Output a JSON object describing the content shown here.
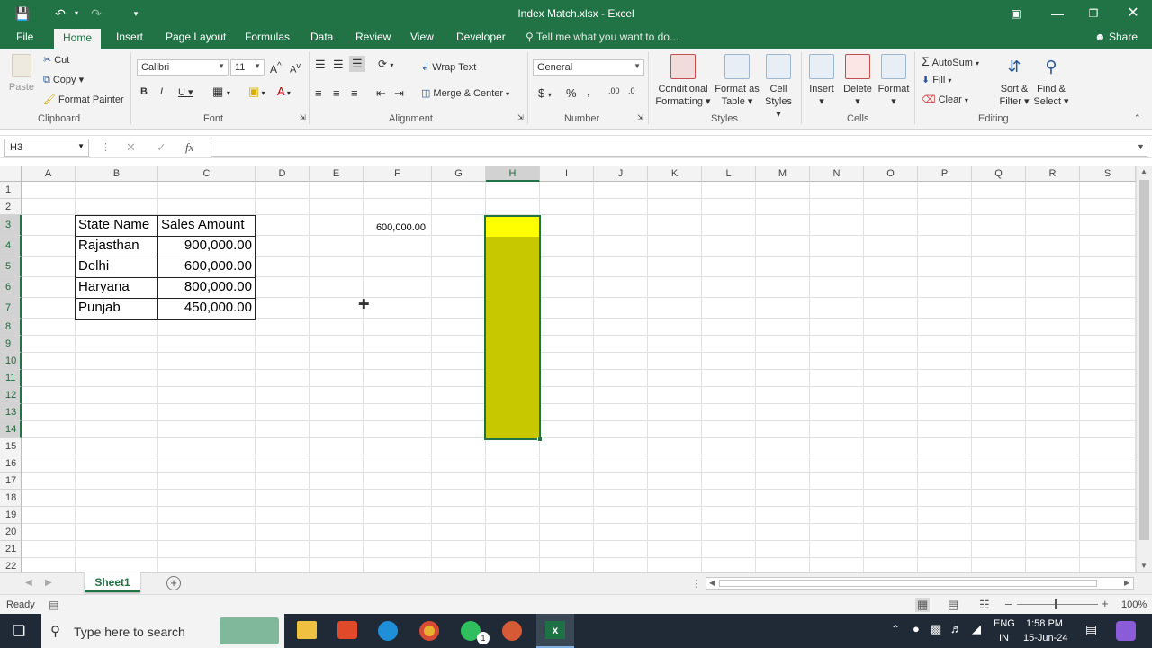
{
  "window": {
    "title": "Index Match.xlsx  -  Excel"
  },
  "qat": {
    "save_icon": "save-icon",
    "undo_icon": "undo-icon",
    "redo_icon": "redo-icon",
    "customize_icon": "customize-icon"
  },
  "tabs": [
    "File",
    "Home",
    "Insert",
    "Page Layout",
    "Formulas",
    "Data",
    "Review",
    "View",
    "Developer"
  ],
  "tell_me": "Tell me what you want to do...",
  "share": "Share",
  "clipboard": {
    "paste": "Paste",
    "cut": "Cut",
    "copy": "Copy",
    "format_painter": "Format Painter",
    "label": "Clipboard"
  },
  "font": {
    "name": "Calibri",
    "size": "11",
    "label": "Font"
  },
  "alignment": {
    "wrap": "Wrap Text",
    "merge": "Merge & Center",
    "label": "Alignment"
  },
  "number": {
    "format": "General",
    "label": "Number"
  },
  "styles": {
    "conditional": [
      "Conditional",
      "Formatting"
    ],
    "format_table": [
      "Format as",
      "Table"
    ],
    "cell_styles": [
      "Cell",
      "Styles"
    ],
    "label": "Styles"
  },
  "cells": {
    "insert": "Insert",
    "delete": "Delete",
    "format": "Format",
    "label": "Cells"
  },
  "editing": {
    "autosum": "AutoSum",
    "fill": "Fill",
    "clear": "Clear",
    "sort": [
      "Sort &",
      "Filter"
    ],
    "find": [
      "Find &",
      "Select"
    ],
    "label": "Editing"
  },
  "formula_bar": {
    "name_box": "H3",
    "fx": "fx",
    "value": ""
  },
  "columns": [
    "A",
    "B",
    "C",
    "D",
    "E",
    "F",
    "G",
    "H",
    "I",
    "J",
    "K",
    "L",
    "M",
    "N",
    "O",
    "P",
    "Q",
    "R",
    "S"
  ],
  "rows": [
    "1",
    "2",
    "3",
    "4",
    "5",
    "6",
    "7",
    "8",
    "9",
    "10",
    "11",
    "12",
    "13",
    "14",
    "15",
    "16",
    "17",
    "18",
    "19",
    "20",
    "21",
    "22"
  ],
  "table": {
    "headers": [
      "State Name",
      "Sales Amount"
    ],
    "rows": [
      [
        "Rajasthan",
        "900,000.00"
      ],
      [
        "Delhi",
        "600,000.00"
      ],
      [
        "Haryana",
        "800,000.00"
      ],
      [
        "Punjab",
        "450,000.00"
      ]
    ]
  },
  "f3_value": "600,000.00",
  "selection": {
    "range": "H3:H14",
    "fill_color": "#c8c800",
    "active_fill": "#ffff00"
  },
  "sheet": {
    "tab": "Sheet1"
  },
  "status": {
    "ready": "Ready",
    "zoom": "100%"
  },
  "taskbar": {
    "search_placeholder": "Type here to search",
    "lang1": "ENG",
    "lang2": "IN",
    "time": "1:58 PM",
    "date": "15-Jun-24",
    "badge": "1"
  }
}
